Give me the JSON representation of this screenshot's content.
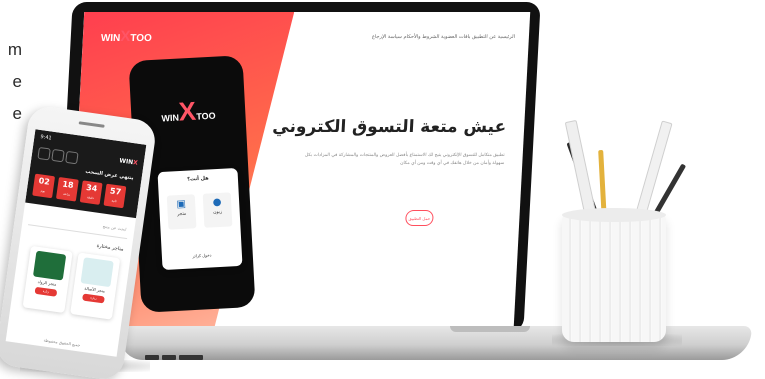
{
  "partial_text": [
    "m",
    "e",
    "e"
  ],
  "laptop": {
    "logo_text": "WIN",
    "logo_x": "X",
    "logo_suffix": "TOO",
    "nav_text": "الرئيسية   عن التطبيق   باقات العضوية   الشروط والأحكام   سياسة الإرجاع",
    "hero_title": "عيش متعة التسوق الكتروني",
    "hero_paragraph": "تطبيق متكامل للتسوق الإلكتروني يتيح لك الاستمتاع بأفضل العروض والمنتجات والمشاركة في المزادات بكل سهولة وأمان من خلال هاتفك في أي وقت ومن أي مكان",
    "hero_button": "حمل التطبيق",
    "inner_phone": {
      "logo_text": "WIN",
      "logo_x": "X",
      "logo_suffix": "TOO",
      "card_title": "هل أنت؟",
      "option_customer": "زبون",
      "option_store": "متجر",
      "card_link": "دخول كزائر"
    }
  },
  "front_phone": {
    "time": "9:41",
    "logo": "WIN",
    "logo_x": "X",
    "sale_label": "ينتهي عرض السحب",
    "timer": [
      {
        "value": "02",
        "label": "يوم"
      },
      {
        "value": "18",
        "label": "ساعة"
      },
      {
        "value": "34",
        "label": "دقيقة"
      },
      {
        "value": "57",
        "label": "ثانية"
      }
    ],
    "search_placeholder": "ابحث عن منتج",
    "section_title": "متاجر مختارة",
    "cards": [
      {
        "name": "متجر الرواد",
        "button": "زيارة"
      },
      {
        "name": "متجر الأصالة",
        "button": "زيارة"
      }
    ],
    "footer": "جميع الحقوق محفوظة"
  },
  "colors": {
    "brand_red": "#e53935",
    "hero_gradient_start": "#ff3f4f",
    "hero_gradient_end": "#ffb9a2"
  }
}
